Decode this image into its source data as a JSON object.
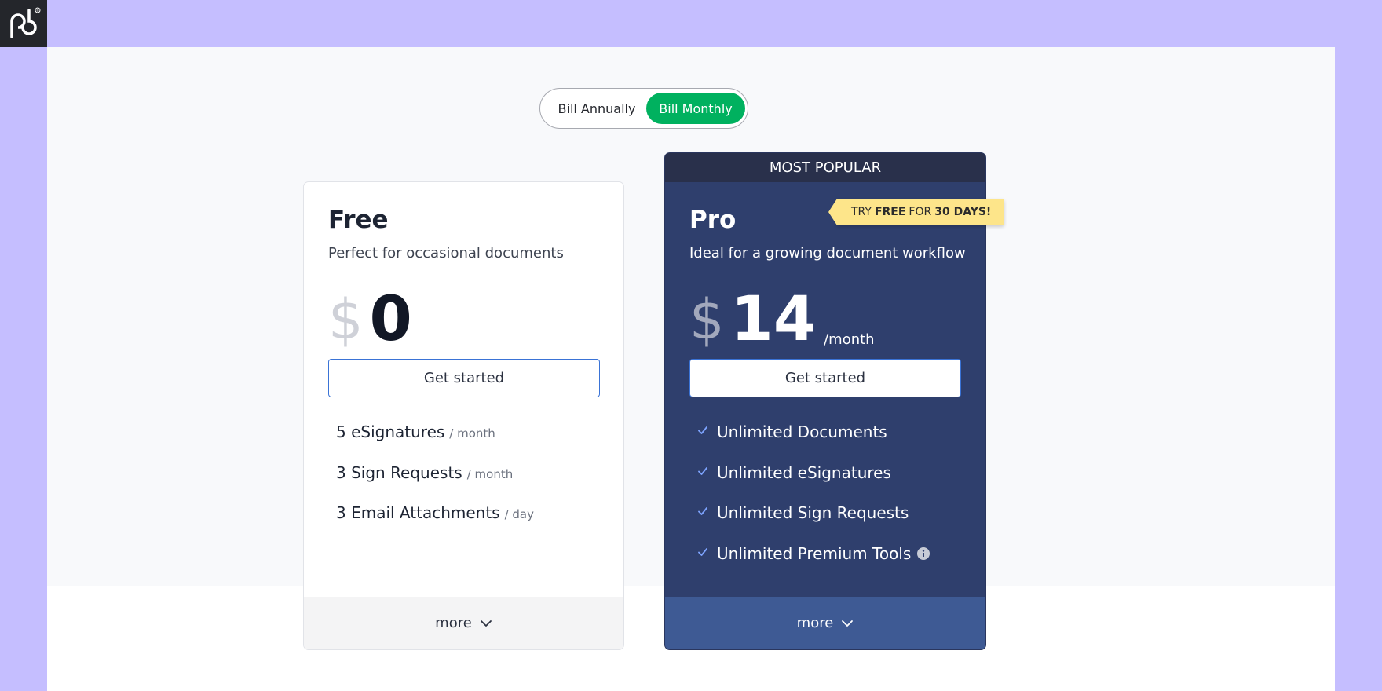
{
  "logo": {
    "mark": "pd",
    "registered": "®"
  },
  "billing_toggle": {
    "annual_label": "Bill Annually",
    "monthly_label": "Bill Monthly",
    "selected": "monthly"
  },
  "plans": {
    "free": {
      "name": "Free",
      "description": "Perfect for occasional documents",
      "currency": "$",
      "price": "0",
      "cta_label": "Get started",
      "features": [
        {
          "text": "5 eSignatures",
          "unit": "/ month"
        },
        {
          "text": "3 Sign Requests",
          "unit": "/ month"
        },
        {
          "text": "3 Email Attachments",
          "unit": "/ day"
        }
      ],
      "more_label": "more"
    },
    "pro": {
      "banner": "MOST POPULAR",
      "name": "Pro",
      "description": "Ideal for a growing document workflow",
      "currency": "$",
      "price": "14",
      "period": "/month",
      "cta_label": "Get started",
      "trial_badge": {
        "prefix": "TRY",
        "free": "FREE",
        "for": "FOR",
        "days": "30 DAYS!"
      },
      "features": [
        {
          "text": "Unlimited Documents"
        },
        {
          "text": "Unlimited eSignatures"
        },
        {
          "text": "Unlimited Sign Requests"
        },
        {
          "text": "Unlimited Premium Tools",
          "info_icon": "info-icon"
        }
      ],
      "more_label": "more"
    }
  },
  "colors": {
    "page_background": "#c5beff",
    "accent_green": "#00b15f",
    "pro_card": "#2f3f6d",
    "pro_banner": "#29304b",
    "badge_yellow": "#fde58a",
    "button_border": "#3a73d6"
  }
}
